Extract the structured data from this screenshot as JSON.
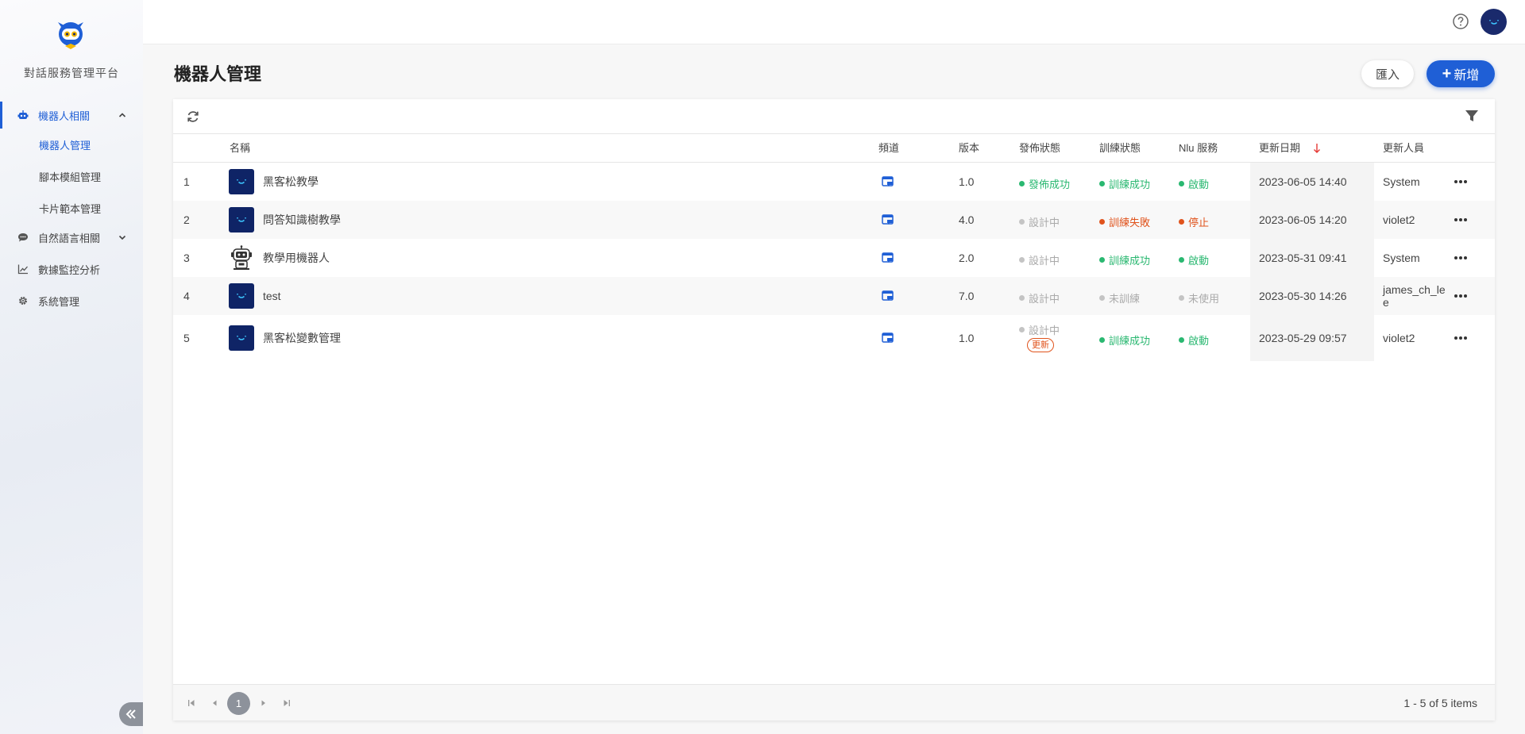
{
  "sidebar": {
    "brand": "對話服務管理平台",
    "nav": [
      {
        "label": "機器人相關",
        "icon": "robot-icon",
        "expanded": true
      },
      {
        "label": "自然語言相關",
        "icon": "chat-bubble-icon",
        "expanded": false
      },
      {
        "label": "數據監控分析",
        "icon": "line-chart-icon"
      },
      {
        "label": "系統管理",
        "icon": "gear-icon"
      }
    ],
    "sub_items": [
      "機器人管理",
      "腳本模組管理",
      "卡片範本管理"
    ]
  },
  "page": {
    "title": "機器人管理",
    "import_label": "匯入",
    "add_label": "新增"
  },
  "table": {
    "columns": {
      "name": "名稱",
      "channel": "頻道",
      "version": "版本",
      "publish_status": "發佈狀態",
      "train_status": "訓練狀態",
      "nlu_service": "Nlu 服務",
      "updated_date": "更新日期",
      "updated_by": "更新人員"
    },
    "rows": [
      {
        "index": "1",
        "name": "黑客松教學",
        "version": "1.0",
        "publish": "發佈成功",
        "train": "訓練成功",
        "nlu": "啟動",
        "date": "2023-06-05 14:40",
        "user": "System",
        "badge": ""
      },
      {
        "index": "2",
        "name": "問答知識樹教學",
        "version": "4.0",
        "publish": "設計中",
        "train": "訓練失敗",
        "nlu": "停止",
        "date": "2023-06-05 14:20",
        "user": "violet2",
        "badge": ""
      },
      {
        "index": "3",
        "name": "教學用機器人",
        "version": "2.0",
        "publish": "設計中",
        "train": "訓練成功",
        "nlu": "啟動",
        "date": "2023-05-31 09:41",
        "user": "System",
        "badge": ""
      },
      {
        "index": "4",
        "name": "test",
        "version": "7.0",
        "publish": "設計中",
        "train": "未訓練",
        "nlu": "未使用",
        "date": "2023-05-30 14:26",
        "user": "james_ch_le\ne",
        "badge": ""
      },
      {
        "index": "5",
        "name": "黑客松變數管理",
        "version": "1.0",
        "publish": "設計中",
        "train": "訓練成功",
        "nlu": "啟動",
        "date": "2023-05-29 09:57",
        "user": "violet2",
        "badge": "更新"
      }
    ]
  },
  "pagination": {
    "current_page": "1",
    "summary": "1 - 5 of 5 items"
  },
  "colors": {
    "primary": "#1f5fd6",
    "success": "#2ab871",
    "error": "#e0531c",
    "muted": "#aaaaaa",
    "avatar_bg": "#0f2466"
  }
}
